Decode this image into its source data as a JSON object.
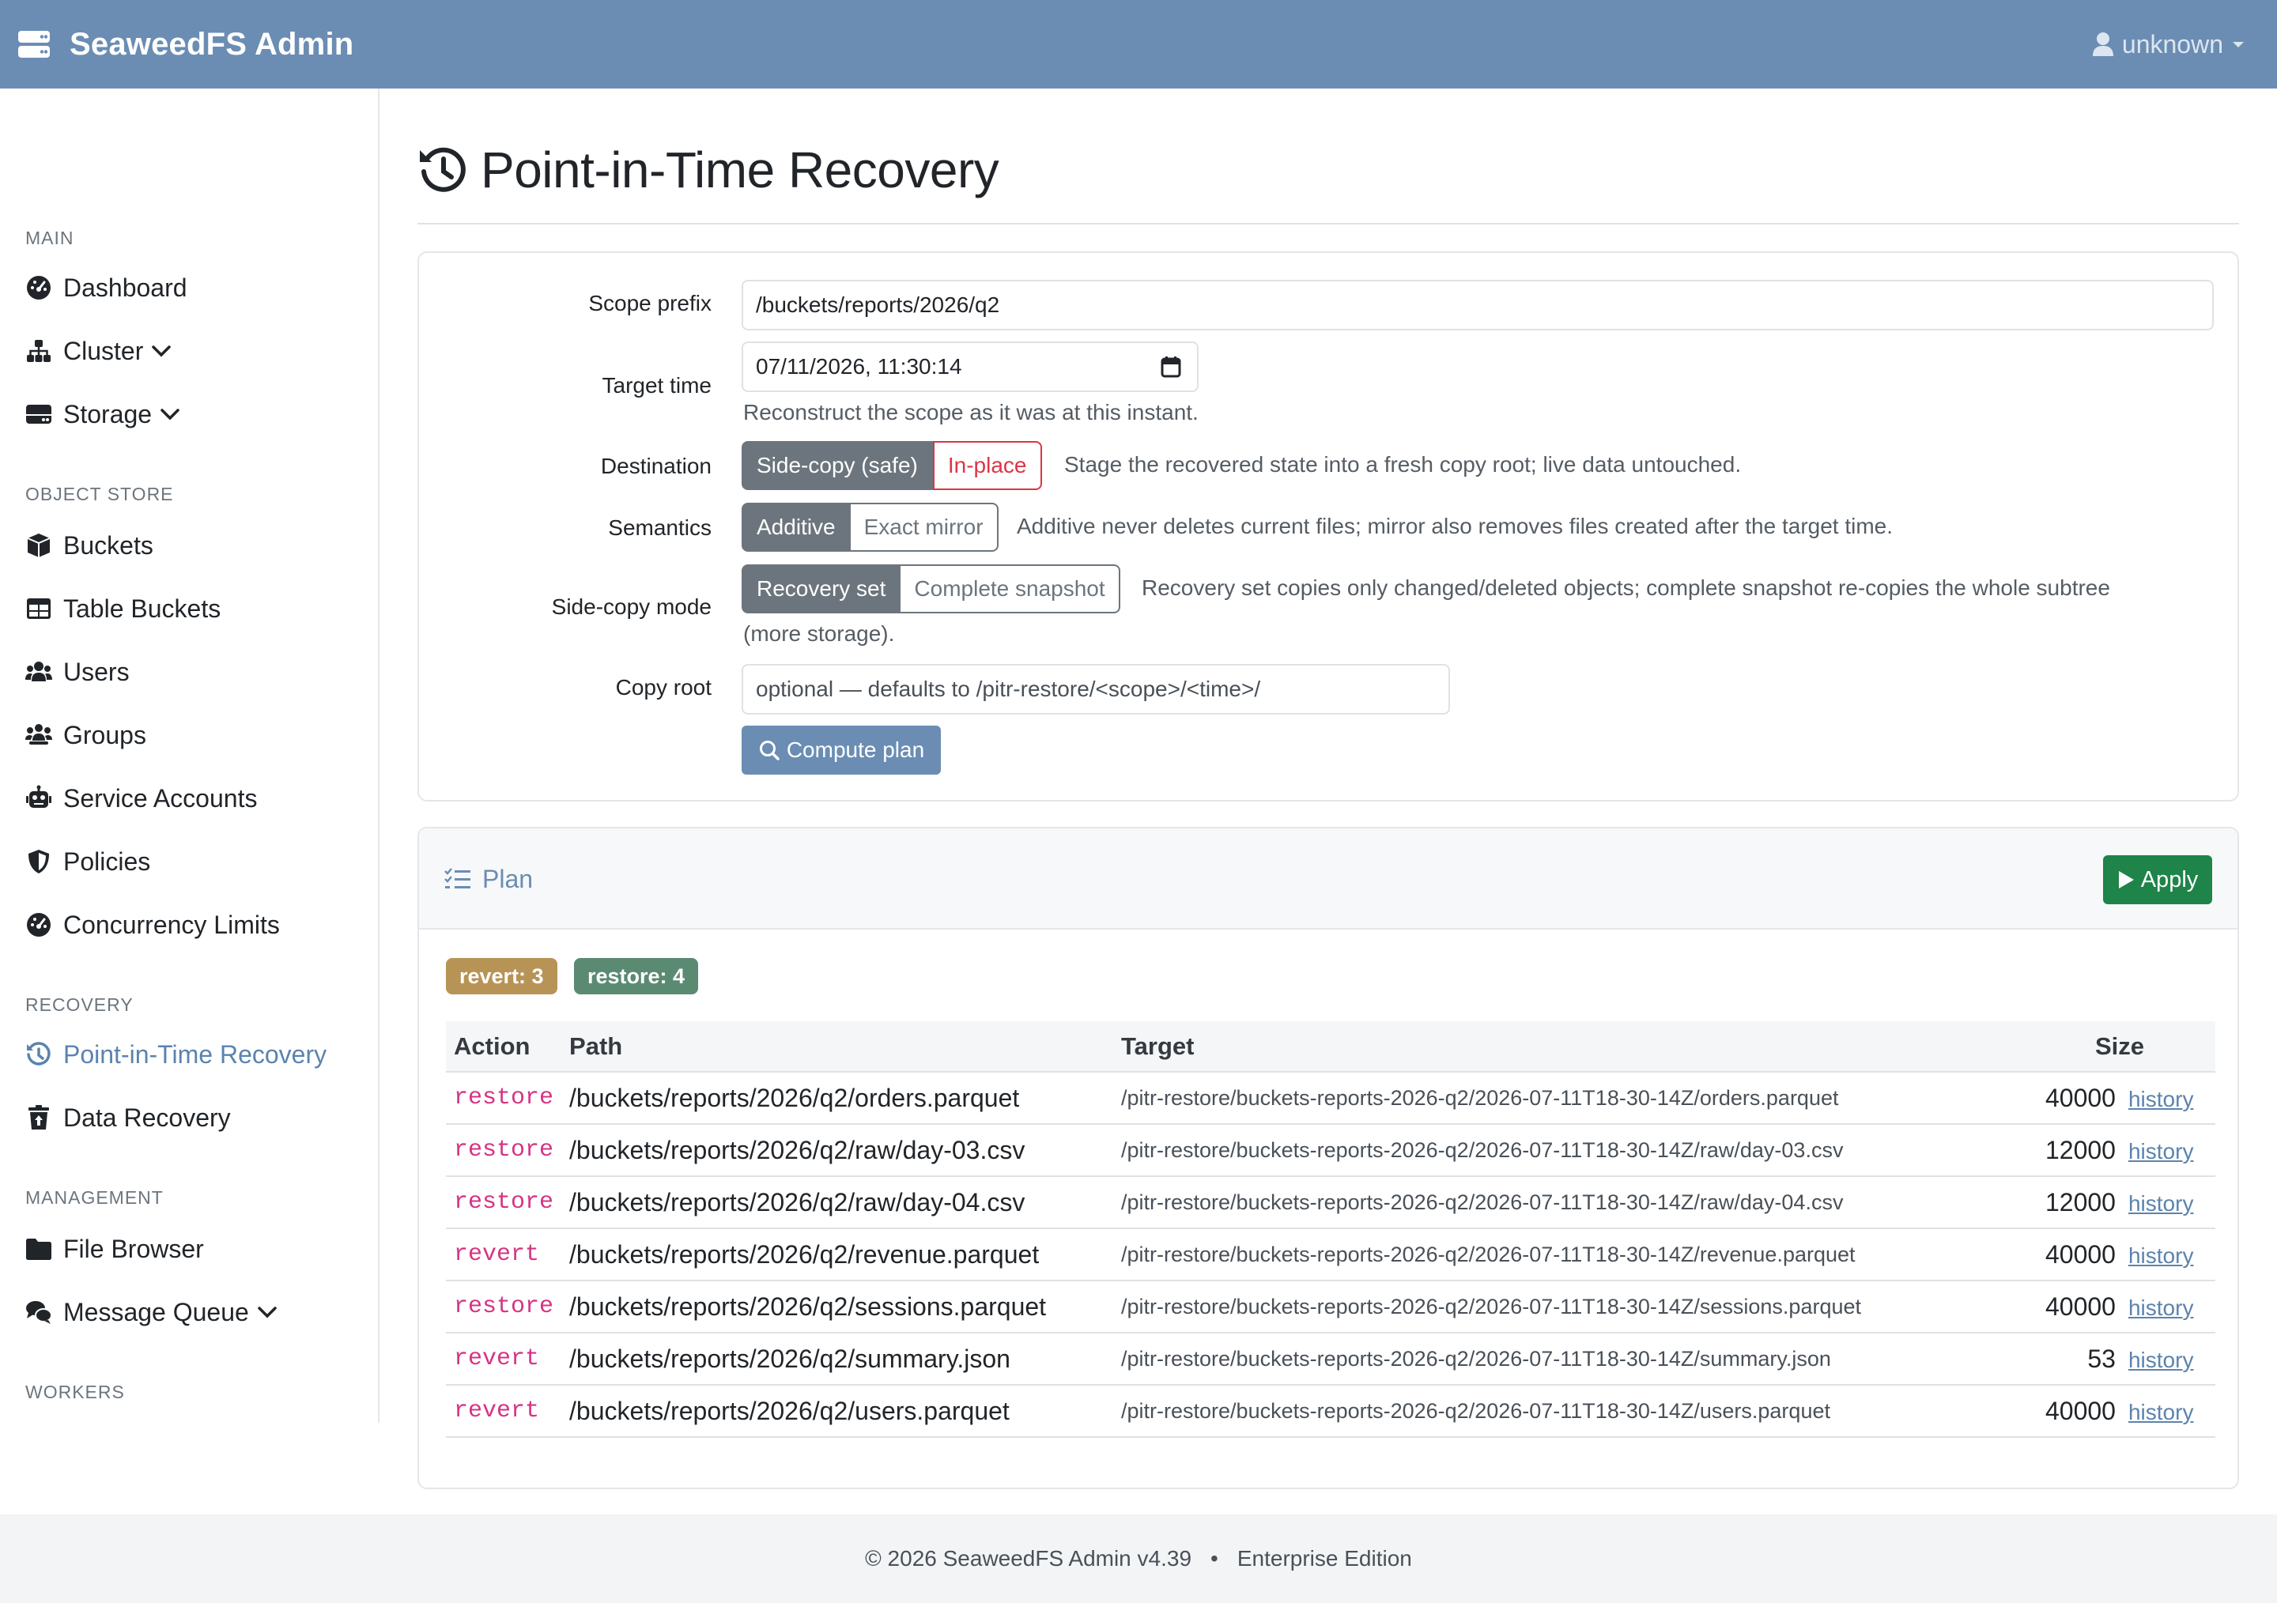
{
  "navbar": {
    "brand": "SeaweedFS Admin",
    "user": "unknown"
  },
  "sidebar": {
    "sections": {
      "main": "MAIN",
      "object_store": "OBJECT STORE",
      "recovery": "RECOVERY",
      "management": "MANAGEMENT",
      "workers": "WORKERS"
    },
    "items": {
      "dashboard": "Dashboard",
      "cluster": "Cluster",
      "storage": "Storage",
      "buckets": "Buckets",
      "table_buckets": "Table Buckets",
      "users": "Users",
      "groups": "Groups",
      "service_accounts": "Service Accounts",
      "policies": "Policies",
      "concurrency_limits": "Concurrency Limits",
      "pitr": "Point-in-Time Recovery",
      "data_recovery": "Data Recovery",
      "file_browser": "File Browser",
      "message_queue": "Message Queue"
    }
  },
  "page": {
    "title": "Point-in-Time Recovery"
  },
  "form": {
    "scope_prefix": {
      "label": "Scope prefix",
      "value": "/buckets/reports/2026/q2"
    },
    "target_time": {
      "label": "Target time",
      "value": "07/11/2026, 11:30:14",
      "help": "Reconstruct the scope as it was at this instant."
    },
    "destination": {
      "label": "Destination",
      "options": [
        "Side-copy (safe)",
        "In-place"
      ],
      "help": "Stage the recovered state into a fresh copy root; live data untouched."
    },
    "semantics": {
      "label": "Semantics",
      "options": [
        "Additive",
        "Exact mirror"
      ],
      "help": "Additive never deletes current files; mirror also removes files created after the target time."
    },
    "side_copy_mode": {
      "label": "Side-copy mode",
      "options": [
        "Recovery set",
        "Complete snapshot"
      ],
      "help_line1": "Recovery set copies only changed/deleted objects; complete snapshot re-copies the whole subtree",
      "help_line2": "(more storage)."
    },
    "copy_root": {
      "label": "Copy root",
      "placeholder": "optional — defaults to /pitr-restore/<scope>/<time>/"
    },
    "compute_label": "Compute plan"
  },
  "plan": {
    "title": "Plan",
    "apply_label": "Apply",
    "badges": {
      "revert": "revert: 3",
      "restore": "restore: 4"
    },
    "columns": [
      "Action",
      "Path",
      "Target",
      "Size"
    ],
    "rows": [
      {
        "action": "restore",
        "path": "/buckets/reports/2026/q2/orders.parquet",
        "target": "/pitr-restore/buckets-reports-2026-q2/2026-07-11T18-30-14Z/orders.parquet",
        "size": "40000",
        "link": "history"
      },
      {
        "action": "restore",
        "path": "/buckets/reports/2026/q2/raw/day-03.csv",
        "target": "/pitr-restore/buckets-reports-2026-q2/2026-07-11T18-30-14Z/raw/day-03.csv",
        "size": "12000",
        "link": "history"
      },
      {
        "action": "restore",
        "path": "/buckets/reports/2026/q2/raw/day-04.csv",
        "target": "/pitr-restore/buckets-reports-2026-q2/2026-07-11T18-30-14Z/raw/day-04.csv",
        "size": "12000",
        "link": "history"
      },
      {
        "action": "revert",
        "path": "/buckets/reports/2026/q2/revenue.parquet",
        "target": "/pitr-restore/buckets-reports-2026-q2/2026-07-11T18-30-14Z/revenue.parquet",
        "size": "40000",
        "link": "history"
      },
      {
        "action": "restore",
        "path": "/buckets/reports/2026/q2/sessions.parquet",
        "target": "/pitr-restore/buckets-reports-2026-q2/2026-07-11T18-30-14Z/sessions.parquet",
        "size": "40000",
        "link": "history"
      },
      {
        "action": "revert",
        "path": "/buckets/reports/2026/q2/summary.json",
        "target": "/pitr-restore/buckets-reports-2026-q2/2026-07-11T18-30-14Z/summary.json",
        "size": "53",
        "link": "history"
      },
      {
        "action": "revert",
        "path": "/buckets/reports/2026/q2/users.parquet",
        "target": "/pitr-restore/buckets-reports-2026-q2/2026-07-11T18-30-14Z/users.parquet",
        "size": "40000",
        "link": "history"
      }
    ]
  },
  "footer": {
    "copyright": "© 2026 SeaweedFS Admin v4.39",
    "separator": "•",
    "edition": "Enterprise Edition"
  },
  "colors": {
    "navbar": "#6b8db3",
    "accent": "#5b83ae",
    "apply": "#1e8449",
    "badge_revert": "#b89356",
    "badge_restore": "#5a8a72",
    "action_text": "#d63384",
    "danger": "#dc3545"
  },
  "icons": {
    "brand": "server-icon",
    "user": "user-icon",
    "dashboard": "gauge-icon",
    "cluster": "sitemap-icon",
    "storage": "hdd-icon",
    "buckets": "cube-icon",
    "table_buckets": "table-icon",
    "users": "users-icon",
    "groups": "users-group-icon",
    "service_accounts": "robot-icon",
    "policies": "shield-icon",
    "concurrency_limits": "gauge-icon",
    "pitr": "history-icon",
    "data_recovery": "trash-restore-icon",
    "file_browser": "folder-icon",
    "message_queue": "comments-icon",
    "compute": "search-icon",
    "plan": "list-check-icon",
    "apply": "play-icon",
    "calendar": "calendar-icon"
  }
}
